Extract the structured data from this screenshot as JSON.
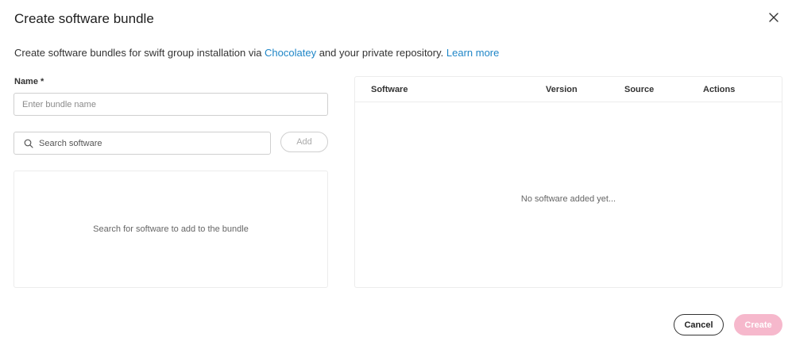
{
  "dialog": {
    "title": "Create software bundle",
    "description_prefix": "Create software bundles for swift group installation via ",
    "chocolatey_link": "Chocolatey",
    "description_middle": " and your private repository. ",
    "learn_more_link": "Learn more"
  },
  "form": {
    "name_label": "Name *",
    "name_placeholder": "Enter bundle name",
    "name_value": "",
    "search_placeholder": "Search software",
    "search_value": "",
    "add_label": "Add",
    "results_empty": "Search for software to add to the bundle"
  },
  "table": {
    "columns": [
      "Software",
      "Version",
      "Source",
      "Actions"
    ],
    "rows": [],
    "empty_text": "No software added yet..."
  },
  "footer": {
    "cancel_label": "Cancel",
    "create_label": "Create"
  },
  "colors": {
    "link": "#1f86c7",
    "create_disabled": "#f6b8cc"
  },
  "icons": {
    "close": "close-icon",
    "search": "search-icon"
  }
}
